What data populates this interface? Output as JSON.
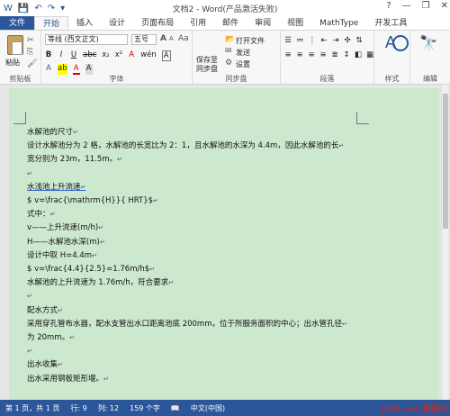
{
  "titlebar": {
    "title": "文档2 - Word(产品激活失败)",
    "help": "?",
    "minimize": "—",
    "restore": "❐",
    "close": "✕"
  },
  "tabs": [
    "文件",
    "开始",
    "插入",
    "设计",
    "页面布局",
    "引用",
    "邮件",
    "审阅",
    "视图",
    "MathType",
    "开发工具"
  ],
  "ribbon": {
    "clipboard": {
      "paste": "粘贴",
      "label": "剪贴板"
    },
    "font": {
      "family": "等线 (西文正文)",
      "size": "五号",
      "grow": "A",
      "shrink": "A",
      "case": "Aa",
      "clear": "A",
      "wen": "wén",
      "char_border": "A",
      "bold": "B",
      "italic": "I",
      "underline": "U",
      "strike": "abc",
      "sub": "x₂",
      "sup": "x²",
      "label": "字体"
    },
    "sync": {
      "save_to": "保存至",
      "sync_disk": "同步盘",
      "open_file": "打开文件",
      "send": "发送",
      "settings": "设置",
      "label": "同步盘"
    },
    "paragraph": {
      "label": "段落"
    },
    "styles": {
      "label": "样式"
    },
    "editing": {
      "label": "编辑"
    }
  },
  "document": {
    "lines": [
      "水解池的尺寸",
      "设计水解池分为 2 格，水解池的长宽比为 2：1，且水解池的水深为 4.4m，因此水解池的长",
      "宽分别为 23m，11.5m。",
      "",
      "水浅池上升流速",
      "$ v=\\frac{\\mathrm{H}}{ HRT}$",
      "式中：",
      "v——上升流速(m/h)",
      "H——水解池水深(m)",
      "设计中取 H=4.4m",
      "$ v=\\frac{4.4}{2.5}=1.76m/h$",
      "水解池的上升流速为 1.76m/h，符合要求",
      "",
      "配水方式",
      "采用穿孔管布水器，配水支管出水口距离池底 200mm，位于所服务面积的中心；出水管孔径",
      "为 20mm。",
      "",
      "出水收集",
      "出水采用钢板矩形堰。"
    ]
  },
  "status": {
    "page": "第 1 页，共 1 页",
    "row": "行: 9",
    "col": "列: 12",
    "chars": "159 个字",
    "lang": "中文(中国)"
  },
  "watermark": "jb51.net 教程网"
}
